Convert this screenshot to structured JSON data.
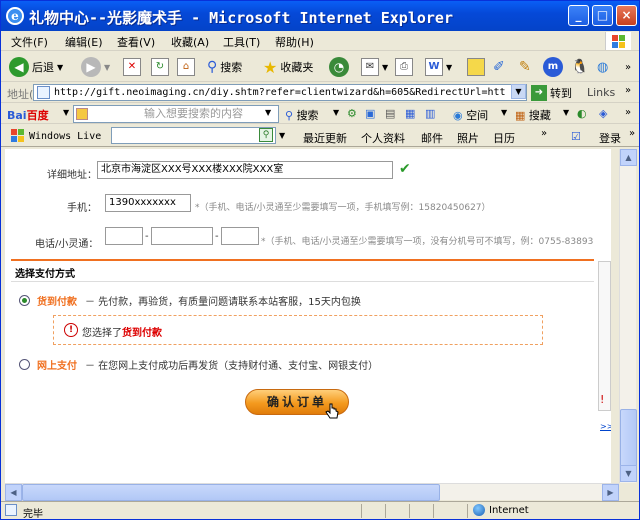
{
  "window": {
    "title": "礼物中心--光影魔术手 - Microsoft Internet Explorer",
    "min_label": "_",
    "max_label": "□",
    "close_label": "×"
  },
  "menubar": {
    "items": [
      "文件(F)",
      "编辑(E)",
      "查看(V)",
      "收藏(A)",
      "工具(T)",
      "帮助(H)"
    ]
  },
  "toolbar": {
    "back_label": "后退",
    "search_label": "搜索",
    "favorites_label": "收藏夹"
  },
  "addressbar": {
    "label": "地址(D)",
    "url": "http://gift.neoimaging.cn/diy.shtm?refer=clientwizard&h=605&RedirectUrl=htt",
    "go_label": "转到",
    "links_label": "Links"
  },
  "baidubar": {
    "logo_prefix": "Bai",
    "logo_suffix": "百度",
    "placeholder": "输入想要搜索的内容",
    "search_label": "搜索",
    "space_label": "空间",
    "collect_label": "搜藏"
  },
  "livebar": {
    "logo_label": "Windows Live",
    "links": [
      "最近更新",
      "个人资料",
      "邮件",
      "照片",
      "日历"
    ],
    "login_label": "登录"
  },
  "form": {
    "address_label": "详细地址：",
    "address_value": "北京市海淀区XXX号XXX楼XXX院XXX室",
    "check_mark": "✔",
    "mobile_label": "手机：",
    "mobile_value": "1390xxxxxxx",
    "mobile_hint": "*（手机、电话/小灵通至少需要填写一项，手机填写例：15820450627）",
    "phone_label": "电话/小灵通：",
    "phone_dash": "-",
    "phone_hint": "*（手机、电话/小灵通至少需要填写一项，没有分机号可不填写，例：0755-83893"
  },
  "payment": {
    "section_title": "选择支付方式",
    "option_cod_name": "货到付款",
    "option_cod_desc": "－ 先付款，再验货，有质量问题请联系本站客服，15天内包换",
    "notice_prefix": "您选择了",
    "notice_selected": "货到付款",
    "notice_icon": "!",
    "option_online_name": "网上支付",
    "option_online_desc": "－ 在您网上支付成功后再发货（支持财付通、支付宝、网银支付）",
    "confirm_label": "确认订单"
  },
  "sidebar": {
    "chars": [
      "订",
      "商",
      "配",
      "订"
    ],
    "link": ">>返"
  },
  "statusbar": {
    "status_text": "完毕",
    "zone_label": "Internet"
  },
  "colors": {
    "title_blue": "#0549d8",
    "accent_orange": "#f07020",
    "price_red": "#d00000",
    "check_green": "#2a9a2a"
  }
}
